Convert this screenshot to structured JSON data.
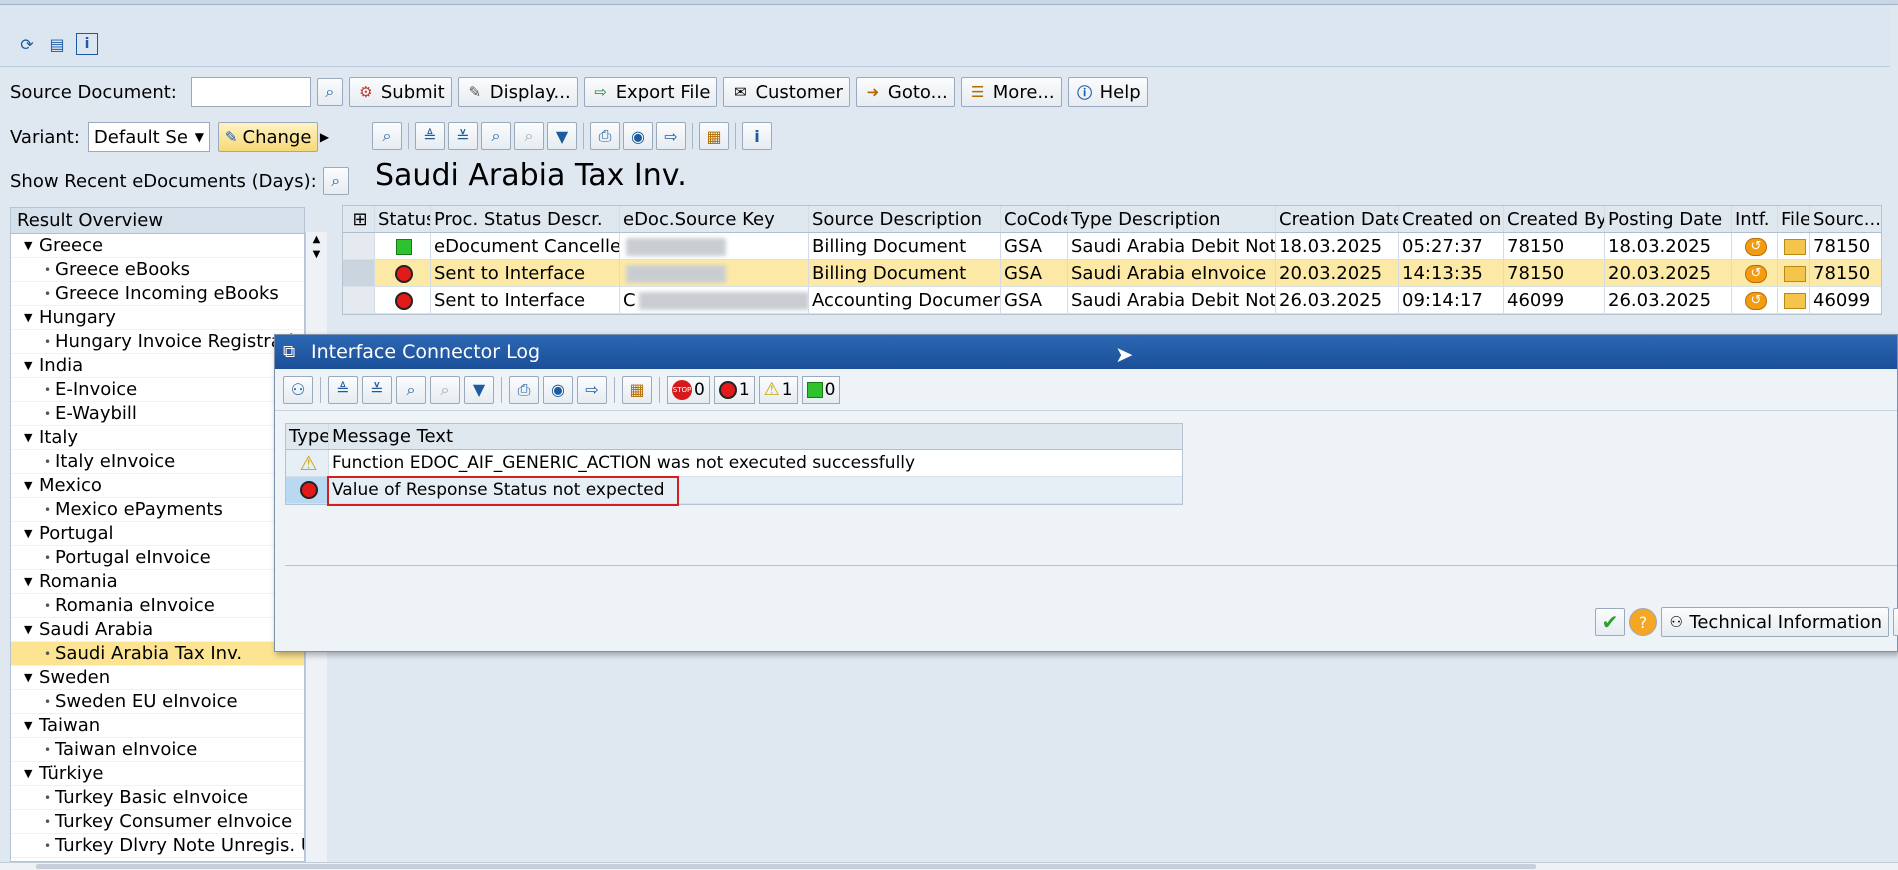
{
  "toolbar_top": {
    "icons": [
      "refresh-icon",
      "layout-icon",
      "info-icon"
    ]
  },
  "source_document": {
    "label": "Source Document:",
    "value": ""
  },
  "action_buttons": [
    {
      "label": "Submit",
      "icon": "submit-icon"
    },
    {
      "label": "Display...",
      "icon": "display-icon"
    },
    {
      "label": "Export File",
      "icon": "export-icon"
    },
    {
      "label": "Customer",
      "icon": "mail-icon"
    },
    {
      "label": "Goto...",
      "icon": "goto-icon"
    },
    {
      "label": "More...",
      "icon": "more-icon"
    },
    {
      "label": "Help",
      "icon": "info-icon"
    }
  ],
  "variant": {
    "label": "Variant:",
    "value": "Default Se",
    "change_label": "Change"
  },
  "recent": {
    "label": "Show Recent eDocuments (Days):"
  },
  "tree": {
    "header": "Result Overview",
    "nodes": [
      {
        "label": "Greece",
        "level": 1
      },
      {
        "label": "Greece eBooks",
        "level": 2
      },
      {
        "label": "Greece Incoming eBooks",
        "level": 2
      },
      {
        "label": "Hungary",
        "level": 1
      },
      {
        "label": "Hungary Invoice Registrati",
        "level": 2
      },
      {
        "label": "India",
        "level": 1
      },
      {
        "label": "E-Invoice",
        "level": 2
      },
      {
        "label": "E-Waybill",
        "level": 2
      },
      {
        "label": "Italy",
        "level": 1
      },
      {
        "label": "Italy eInvoice",
        "level": 2
      },
      {
        "label": "Mexico",
        "level": 1
      },
      {
        "label": "Mexico ePayments",
        "level": 2
      },
      {
        "label": "Portugal",
        "level": 1
      },
      {
        "label": "Portugal eInvoice",
        "level": 2
      },
      {
        "label": "Romania",
        "level": 1
      },
      {
        "label": "Romania eInvoice",
        "level": 2
      },
      {
        "label": "Saudi Arabia",
        "level": 1
      },
      {
        "label": "Saudi Arabia Tax Inv.",
        "level": 2,
        "selected": true
      },
      {
        "label": "Sweden",
        "level": 1
      },
      {
        "label": "Sweden EU eInvoice",
        "level": 2
      },
      {
        "label": "Taiwan",
        "level": 1
      },
      {
        "label": "Taiwan eInvoice",
        "level": 2
      },
      {
        "label": "Türkiye",
        "level": 1
      },
      {
        "label": "Turkey Basic eInvoice",
        "level": 2
      },
      {
        "label": "Turkey Consumer eInvoice",
        "level": 2
      },
      {
        "label": "Turkey Dlvry Note Unregis. Us",
        "level": 2
      }
    ]
  },
  "main": {
    "title": "Saudi Arabia Tax Inv.",
    "columns": [
      "Status",
      "Proc. Status Descr.",
      "eDoc.Source Key",
      "Source Description",
      "CoCode",
      "Type Description",
      "Creation Date",
      "Created on",
      "Created By",
      "Posting Date",
      "Intf.",
      "File",
      "Sourc..."
    ],
    "rows": [
      {
        "status": "green",
        "proc": "eDocument Cancelled",
        "key": "",
        "source_desc": "Billing Document",
        "cocode": "GSA",
        "type_desc": "Saudi Arabia Debit Note",
        "creation_date": "18.03.2025",
        "created_on": "05:27:37",
        "created_by": "78150",
        "posting_date": "18.03.2025",
        "source": "78150",
        "selected": false
      },
      {
        "status": "red",
        "proc": "Sent to Interface",
        "key": "",
        "source_desc": "Billing Document",
        "cocode": "GSA",
        "type_desc": "Saudi Arabia eInvoice",
        "creation_date": "20.03.2025",
        "created_on": "14:13:35",
        "created_by": "78150",
        "posting_date": "20.03.2025",
        "source": "78150",
        "selected": true
      },
      {
        "status": "red",
        "proc": "Sent to Interface",
        "key": "C",
        "source_desc": "Accounting Document",
        "cocode": "GSA",
        "type_desc": "Saudi Arabia Debit Note",
        "creation_date": "26.03.2025",
        "created_on": "09:14:17",
        "created_by": "46099",
        "posting_date": "26.03.2025",
        "source": "46099",
        "selected": false
      }
    ]
  },
  "dialog": {
    "title": "Interface Connector Log",
    "counts": {
      "stop": "0",
      "error": "1",
      "warning": "1",
      "success": "0"
    },
    "columns": [
      "Type",
      "Message Text"
    ],
    "messages": [
      {
        "type": "warning",
        "text": "Function EDOC_AIF_GENERIC_ACTION was not executed successfully"
      },
      {
        "type": "error",
        "text": "Value of Response Status not expected"
      }
    ],
    "footer": {
      "technical_label": "Technical Information"
    }
  },
  "colors": {
    "selected_row": "#fde9a6",
    "title_bar": "#1b4f98",
    "highlight_box": "#d21f1f"
  }
}
